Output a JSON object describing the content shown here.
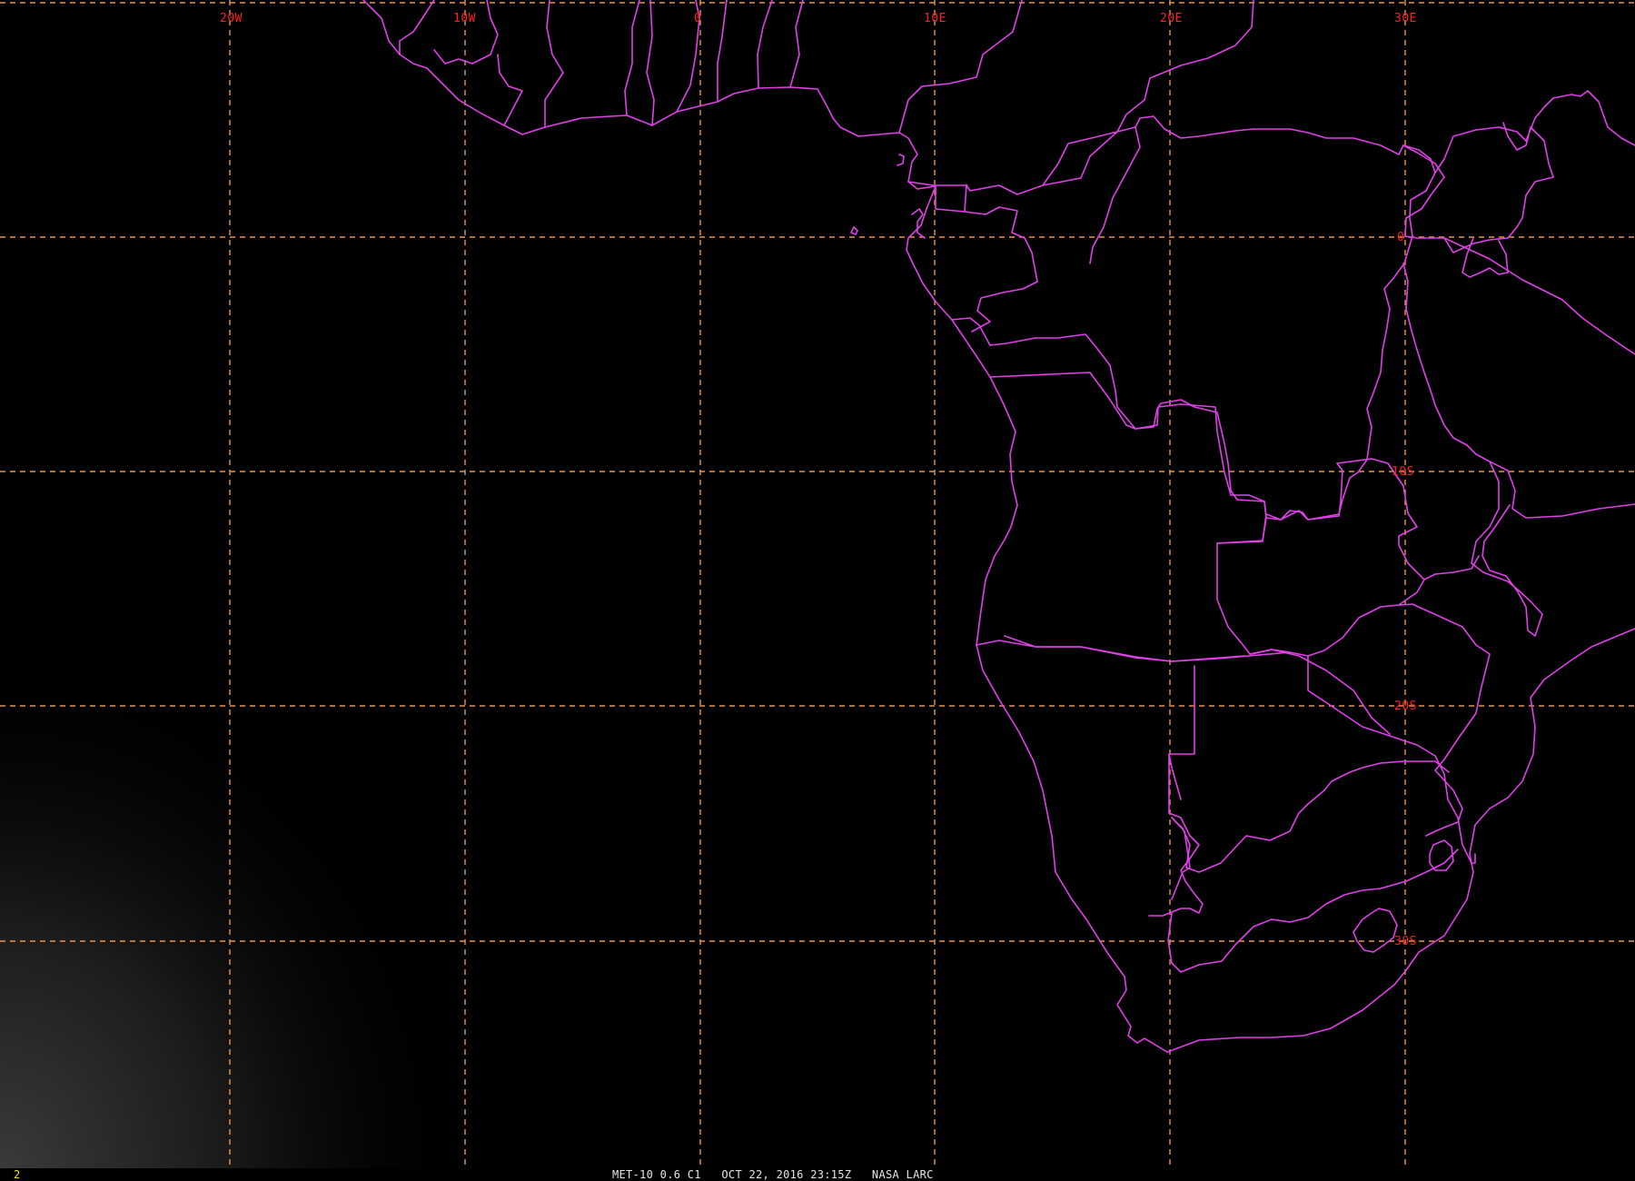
{
  "map": {
    "longitude_labels": [
      "20W",
      "10W",
      "0",
      "10E",
      "20E",
      "30E"
    ],
    "latitude_labels": [
      "0",
      "10S",
      "20S",
      "30S"
    ],
    "colors": {
      "background": "#000000",
      "grid": "#e8954a",
      "grid_label": "#ff2020",
      "border": "#e040e8",
      "frame_number": "#f0e020",
      "caption": "#e6e6e6"
    }
  },
  "status": {
    "frame_number": "2",
    "caption": "MET-10 0.6 C1   OCT 22, 2016 23:15Z   NASA LARC"
  }
}
